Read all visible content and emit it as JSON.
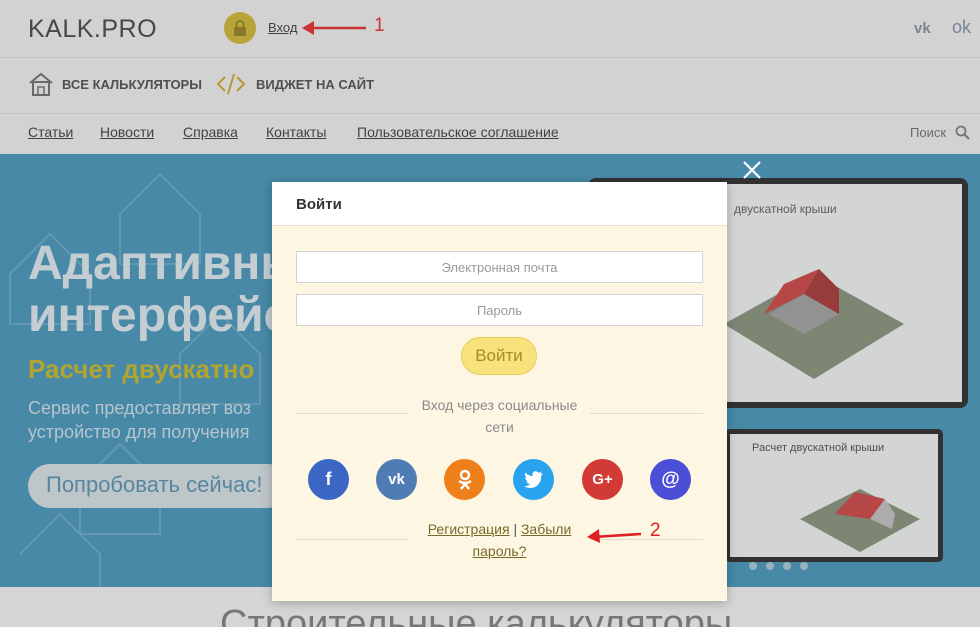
{
  "header": {
    "logo": "KALK.PRO",
    "login_link": "Вход",
    "annotation_1": "1"
  },
  "nav": {
    "all_calculators": "ВСЕ КАЛЬКУЛЯТОРЫ",
    "widget": "ВИДЖЕТ НА САЙТ"
  },
  "links": [
    "Статьи",
    "Новости",
    "Справка",
    "Контакты",
    "Пользовательское соглашение"
  ],
  "search": {
    "label": "Поиск"
  },
  "hero": {
    "title_line1": "Адаптивны",
    "title_line2": "интерфейс",
    "subtitle": "Расчет двускатно",
    "desc_line1": "Сервис предоставляет воз",
    "desc_line2": "устройство для получения",
    "cta": "Попробовать сейчас!",
    "monitor_title": "двускатной крыши",
    "laptop_title": "Расчет двускатной крыши"
  },
  "bottom": {
    "title": "Строительные калькуляторы"
  },
  "modal": {
    "title": "Войти",
    "email_placeholder": "Электронная почта",
    "password_placeholder": "Пароль",
    "submit": "Войти",
    "social_caption": "Вход через социальные сети",
    "social": [
      {
        "name": "facebook",
        "glyph": "f"
      },
      {
        "name": "vkontakte",
        "glyph": "vk"
      },
      {
        "name": "odnoklassniki",
        "glyph": "ok"
      },
      {
        "name": "twitter",
        "glyph": "t"
      },
      {
        "name": "google-plus",
        "glyph": "G+"
      },
      {
        "name": "mail",
        "glyph": "@"
      }
    ],
    "register": "Регистрация",
    "separator": "|",
    "forgot": "Забыли пароль?",
    "annotation_2": "2"
  },
  "colors": {
    "hero_bg": "#3a8fb4",
    "modal_bg": "#fdf6e3",
    "submit_bg": "#f7e27b",
    "annotation": "#e02020",
    "facebook": "#3b66c4",
    "vk": "#4f7db3",
    "ok": "#ef7f1a",
    "twitter": "#2aa3ef",
    "google": "#d13a35",
    "mail": "#4a4fd6"
  }
}
